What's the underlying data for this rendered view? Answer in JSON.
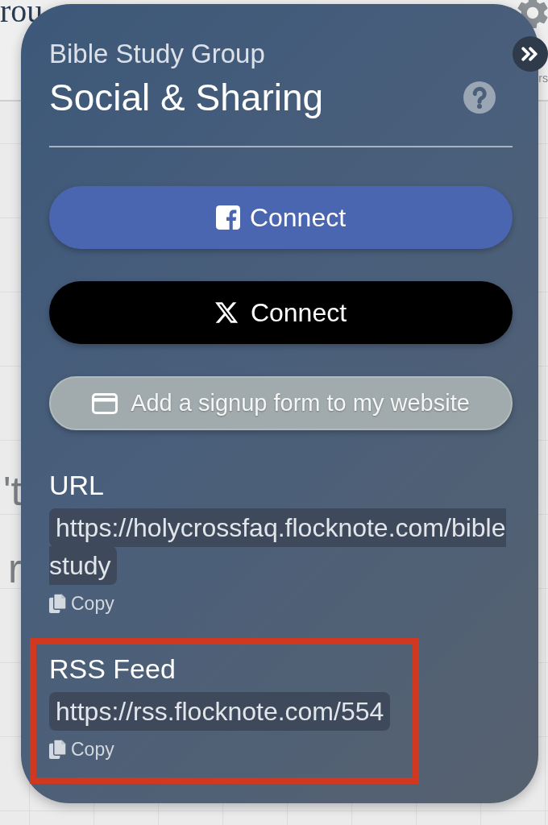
{
  "backdrop": {
    "heading": "rou",
    "side_label": "rs",
    "fragments": [
      "'t",
      "r"
    ]
  },
  "panel": {
    "subtitle": "Bible Study Group",
    "title": "Social & Sharing"
  },
  "buttons": [
    {
      "kind": "facebook",
      "label": "Connect"
    },
    {
      "kind": "x",
      "label": "Connect"
    },
    {
      "kind": "signup",
      "label": "Add a signup form to my website"
    }
  ],
  "sections": [
    {
      "label": "URL",
      "value": "https://holycrossfaq.flocknote.com/biblestudy",
      "copy": "Copy",
      "highlighted": false
    },
    {
      "label": "RSS Feed",
      "value": "https://rss.flocknote.com/554",
      "copy": "Copy",
      "highlighted": true
    }
  ]
}
